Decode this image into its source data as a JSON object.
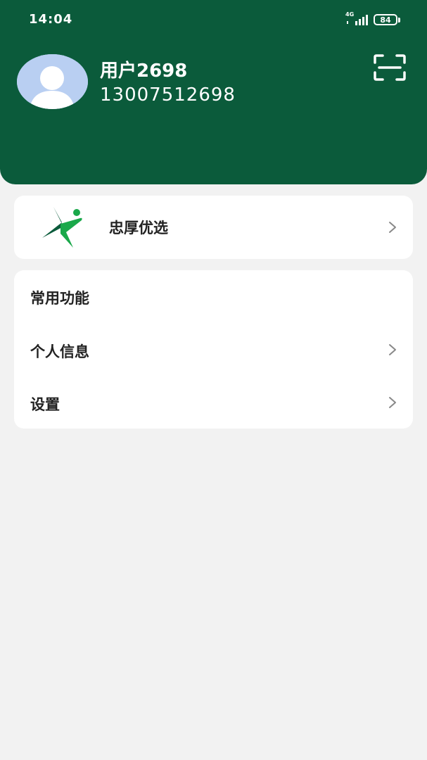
{
  "status_bar": {
    "time": "14:04",
    "network": "4G",
    "battery": "84"
  },
  "profile": {
    "name": "用户2698",
    "phone": "13007512698"
  },
  "icons": {
    "scan": "scan-icon",
    "chevron": "chevron-right-icon",
    "avatar": "default-avatar-icon",
    "brand_logo": "brand-logo-icon"
  },
  "brand": {
    "name": "忠厚优选"
  },
  "menu": {
    "section_title": "常用功能",
    "items": [
      {
        "label": "个人信息"
      },
      {
        "label": "设置"
      }
    ]
  },
  "colors": {
    "header": "#0b5b3b",
    "background": "#f2f2f2",
    "card": "#ffffff",
    "logo_green": "#1aa84a",
    "logo_dark": "#0b5b3b"
  }
}
